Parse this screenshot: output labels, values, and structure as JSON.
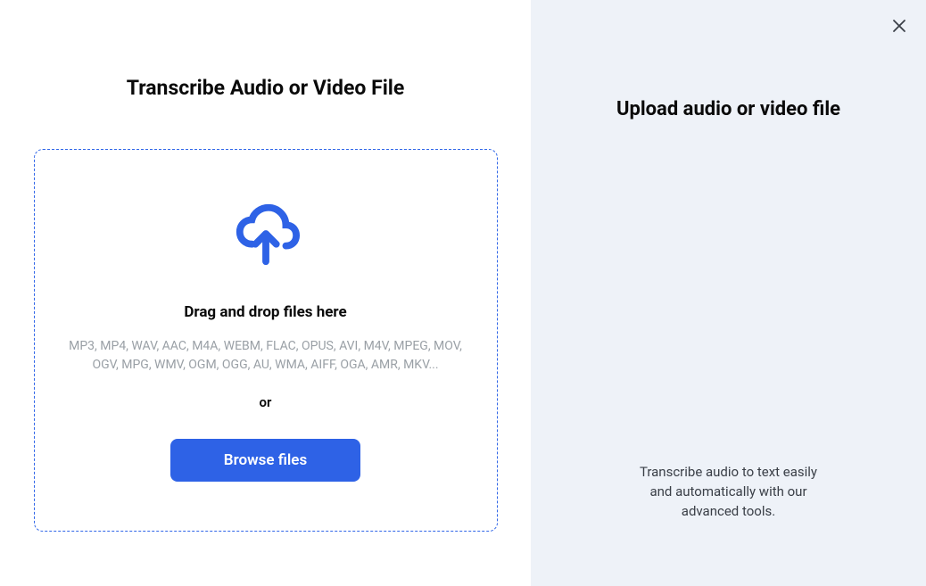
{
  "left": {
    "title": "Transcribe Audio or Video File",
    "drop_label": "Drag and drop files here",
    "formats": "MP3, MP4, WAV, AAC, M4A, WEBM, FLAC, OPUS, AVI, M4V, MPEG, MOV, OGV, MPG, WMV, OGM, OGG, AU, WMA, AIFF, OGA, AMR, MKV...",
    "or": "or",
    "browse_label": "Browse files"
  },
  "right": {
    "title": "Upload audio or video file",
    "description": "Transcribe audio to text easily and automatically with our advanced tools."
  },
  "colors": {
    "primary": "#2e62e6",
    "panel_bg": "#eef2f8"
  }
}
